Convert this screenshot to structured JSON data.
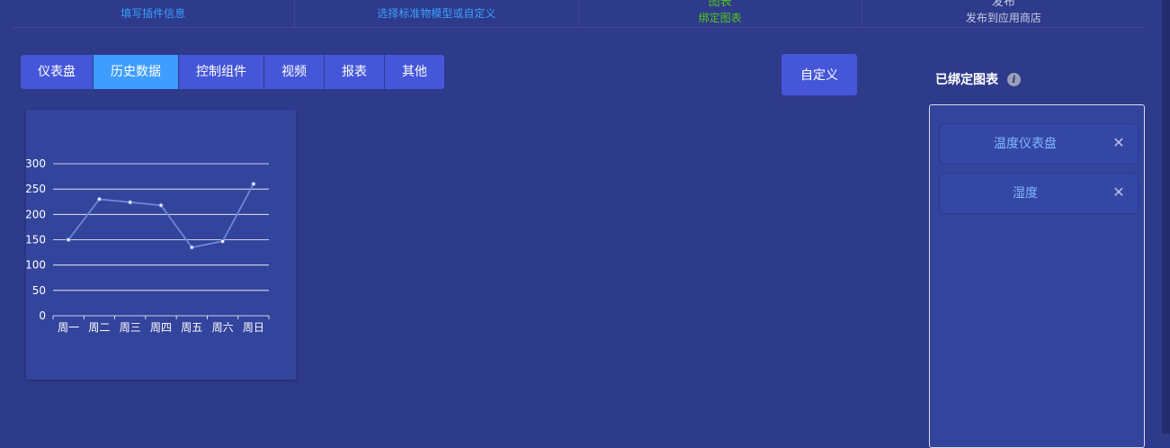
{
  "steps": [
    {
      "label": "填写插件信息",
      "state": "done",
      "top": ""
    },
    {
      "label": "选择标准物模型或自定义",
      "state": "done",
      "top": ""
    },
    {
      "label": "绑定图表",
      "state": "active",
      "top": "图表"
    },
    {
      "label": "发布到应用商店",
      "state": "todo",
      "top": "发布"
    }
  ],
  "tabs": [
    {
      "label": "仪表盘",
      "active": false
    },
    {
      "label": "历史数据",
      "active": true
    },
    {
      "label": "控制组件",
      "active": false
    },
    {
      "label": "视频",
      "active": false
    },
    {
      "label": "报表",
      "active": false
    },
    {
      "label": "其他",
      "active": false
    }
  ],
  "custom_button": "自定义",
  "bound_panel": {
    "title": "已绑定图表",
    "info_icon_glyph": "i",
    "items": [
      {
        "name": "温度仪表盘",
        "close_glyph": "✕"
      },
      {
        "name": "湿度",
        "close_glyph": "✕"
      }
    ]
  },
  "colors": {
    "background": "#2e3a8a",
    "tab": "#4557d8",
    "tab_active": "#3f9dff",
    "step_done": "#3aa0ff",
    "step_active": "#52c41a",
    "line": "#6e86d9"
  },
  "chart_data": {
    "type": "line",
    "categories": [
      "周一",
      "周二",
      "周三",
      "周四",
      "周五",
      "周六",
      "周日"
    ],
    "values": [
      150,
      230,
      224,
      218,
      135,
      147,
      260
    ],
    "yticks": [
      0,
      50,
      100,
      150,
      200,
      250,
      300
    ],
    "ylim": [
      0,
      300
    ],
    "grid": true,
    "legend": "none"
  }
}
